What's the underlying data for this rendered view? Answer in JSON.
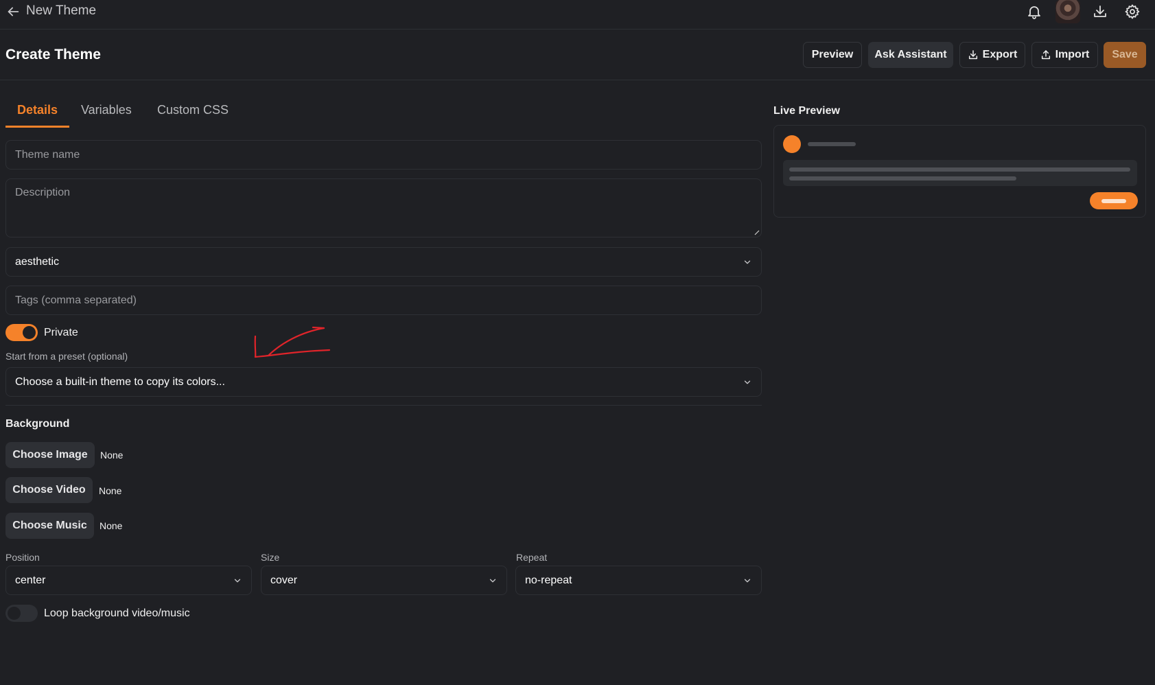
{
  "topbar": {
    "title": "New Theme",
    "icons": [
      "arrow-left-icon",
      "bell-icon",
      "avatar",
      "download-icon",
      "gear-icon"
    ]
  },
  "header": {
    "title": "Create Theme",
    "buttons": {
      "preview": "Preview",
      "ask_assistant": "Ask Assistant",
      "export": "Export",
      "import": "Import",
      "save": "Save"
    }
  },
  "tabs": [
    "Details",
    "Variables",
    "Custom CSS"
  ],
  "active_tab": "Details",
  "form": {
    "theme_name_placeholder": "Theme name",
    "description_placeholder": "Description",
    "category_value": "aesthetic",
    "tags_placeholder": "Tags (comma separated)",
    "private_label": "Private",
    "private_on": true,
    "preset_label": "Start from a preset (optional)",
    "preset_placeholder": "Choose a built-in theme to copy its colors..."
  },
  "background": {
    "title": "Background",
    "image_button": "Choose Image",
    "image_value": "None",
    "video_button": "Choose Video",
    "video_value": "None",
    "music_button": "Choose Music",
    "music_value": "None",
    "position_label": "Position",
    "position_value": "center",
    "size_label": "Size",
    "size_value": "cover",
    "repeat_label": "Repeat",
    "repeat_value": "no-repeat",
    "loop_label": "Loop background video/music",
    "loop_on": false
  },
  "live_preview": {
    "title": "Live Preview"
  },
  "colors": {
    "accent": "#f5822a",
    "background": "#1f2024",
    "border": "#2e3035",
    "annotation": "#e0242a"
  }
}
